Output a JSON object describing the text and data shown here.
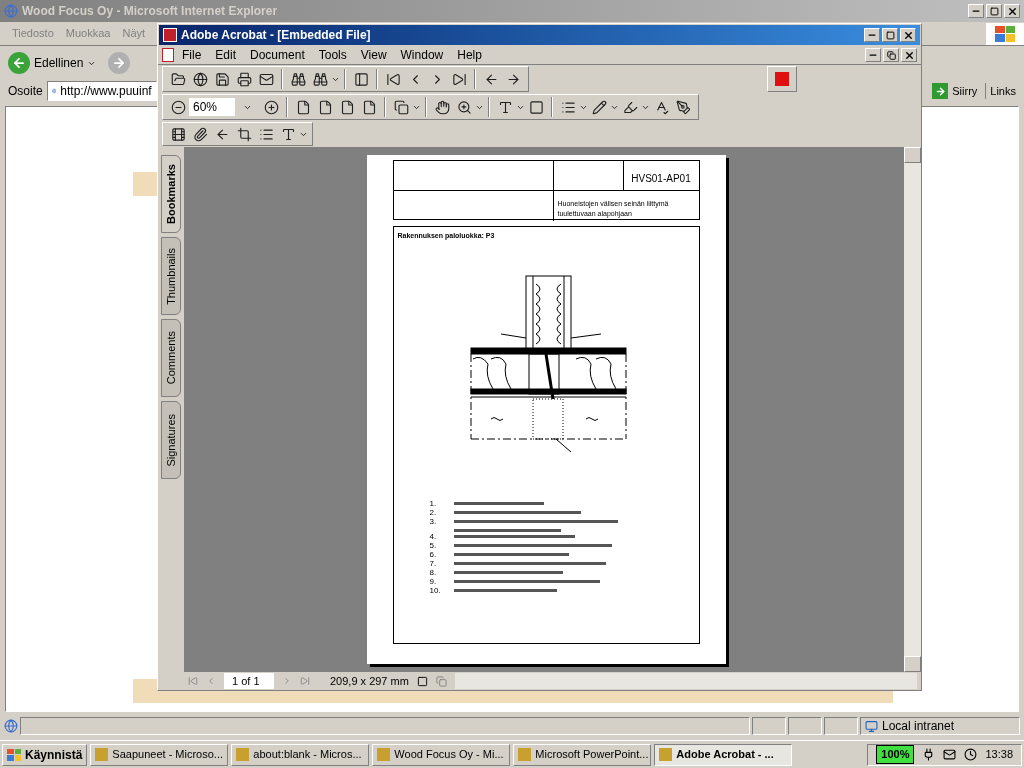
{
  "browser": {
    "title": "Wood Focus Oy - Microsoft Internet Explorer",
    "menu": [
      "Tiedosto",
      "Muokkaa",
      "Näyt"
    ],
    "back_label": "Edellinen",
    "address_label": "Osoite",
    "address": "http://www.puuinf",
    "go_label": "Siirry",
    "links_label": "Links",
    "status_zone": "Local intranet"
  },
  "acrobat": {
    "title": "Adobe Acrobat - [Embedded File]",
    "menu": [
      "File",
      "Edit",
      "Document",
      "Tools",
      "View",
      "Window",
      "Help"
    ],
    "zoom": "60%",
    "side_tabs": [
      {
        "label": "Bookmarks",
        "selected": true
      },
      {
        "label": "Thumbnails",
        "selected": false
      },
      {
        "label": "Comments",
        "selected": false
      },
      {
        "label": "Signatures",
        "selected": false
      }
    ],
    "page_indicator": "1 of 1",
    "page_size": "209,9 x 297 mm",
    "document": {
      "code": "HVS01-AP01",
      "description": "Huoneistojen välisen seinän liittymä tuulettuvaan alapohjaan",
      "heading": "Rakennuksen paloluokka: P3",
      "legend": [
        {
          "number": "1.",
          "kind": "single"
        },
        {
          "number": "2.",
          "kind": "single"
        },
        {
          "number": "3.",
          "kind": "double"
        },
        {
          "number": "4.",
          "kind": "single"
        },
        {
          "number": "5.",
          "kind": "single"
        },
        {
          "number": "6.",
          "kind": "single"
        },
        {
          "number": "7.",
          "kind": "single"
        },
        {
          "number": "8.",
          "kind": "single"
        },
        {
          "number": "9.",
          "kind": "single"
        },
        {
          "number": "10.",
          "kind": "single"
        }
      ]
    }
  },
  "taskbar": {
    "start": "Käynnistä",
    "tasks": [
      {
        "label": "Saapuneet - Microso...",
        "selected": false
      },
      {
        "label": "about:blank - Micros...",
        "selected": false
      },
      {
        "label": "Wood Focus Oy - Mi...",
        "selected": false
      },
      {
        "label": "Microsoft PowerPoint...",
        "selected": false
      },
      {
        "label": "Adobe Acrobat - ...",
        "selected": true
      }
    ],
    "battery": "100%",
    "clock": "13:38"
  }
}
